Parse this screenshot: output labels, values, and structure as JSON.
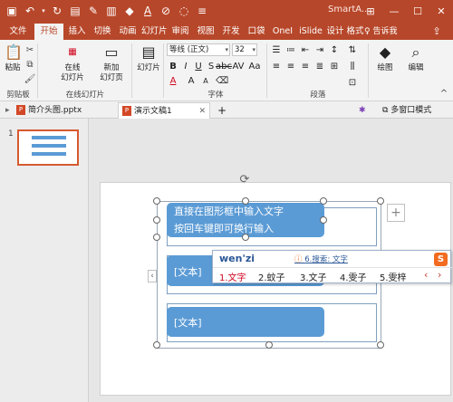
{
  "window": {
    "title": "SmartA...",
    "controls": {
      "ribbon_options": "⊞",
      "minimize": "—",
      "maximize": "☐",
      "close": "✕"
    }
  },
  "qat": {
    "icons": [
      "save-icon",
      "undo-icon",
      "redo-icon",
      "refresh-icon",
      "file-icon",
      "pen-icon",
      "fill-color-icon",
      "font-color-icon",
      "more-icon"
    ]
  },
  "tabs": [
    "文件",
    "开始",
    "插入",
    "切换",
    "动画",
    "幻灯片",
    "审阅",
    "视图",
    "开发",
    "口袋",
    "OneI",
    "iSlide",
    "设计",
    "格式"
  ],
  "active_tab_index": 1,
  "tell_me": "♀ 告诉我",
  "ribbon": {
    "clipboard": {
      "paste": "粘贴",
      "group_label": "剪贴板"
    },
    "slides": {
      "online_slides": "在线\n幻灯片",
      "new_slide": "新加\n幻灯页",
      "group_label": "在线幻灯片"
    },
    "layout": {
      "slides_label": "幻灯片"
    },
    "font": {
      "font_name": "等线 (正文)",
      "font_size": "32",
      "group_label": "字体"
    },
    "paragraph": {
      "group_label": "段落"
    },
    "drawing": {
      "label": "绘图"
    },
    "editing": {
      "label": "编辑"
    }
  },
  "doc_tabs": [
    {
      "label": "简介头图.pptx",
      "active": false
    },
    {
      "label": "演示文稿1",
      "active": true
    }
  ],
  "doc_tab_close": "✕",
  "doc_tab_add": "+",
  "window_mode": "多窗口模式",
  "thumbnail": {
    "number": "1"
  },
  "slide": {
    "row1_line1": "直接在图形框中输入文字",
    "row1_line2": "按回车键即可换行输入",
    "row2_text": "[文本]",
    "row3_text": "[文本]"
  },
  "ime": {
    "input": "wen'zi",
    "search": "6.搜索: 文字",
    "candidates": [
      "1.文字",
      "2.蚊子",
      "3.文子",
      "4.雯子",
      "5.雯梓"
    ],
    "logo": "S"
  },
  "colors": {
    "accent": "#b7472a",
    "shape_fill": "#5b9bd5",
    "ime_highlight": "#d0021b"
  }
}
